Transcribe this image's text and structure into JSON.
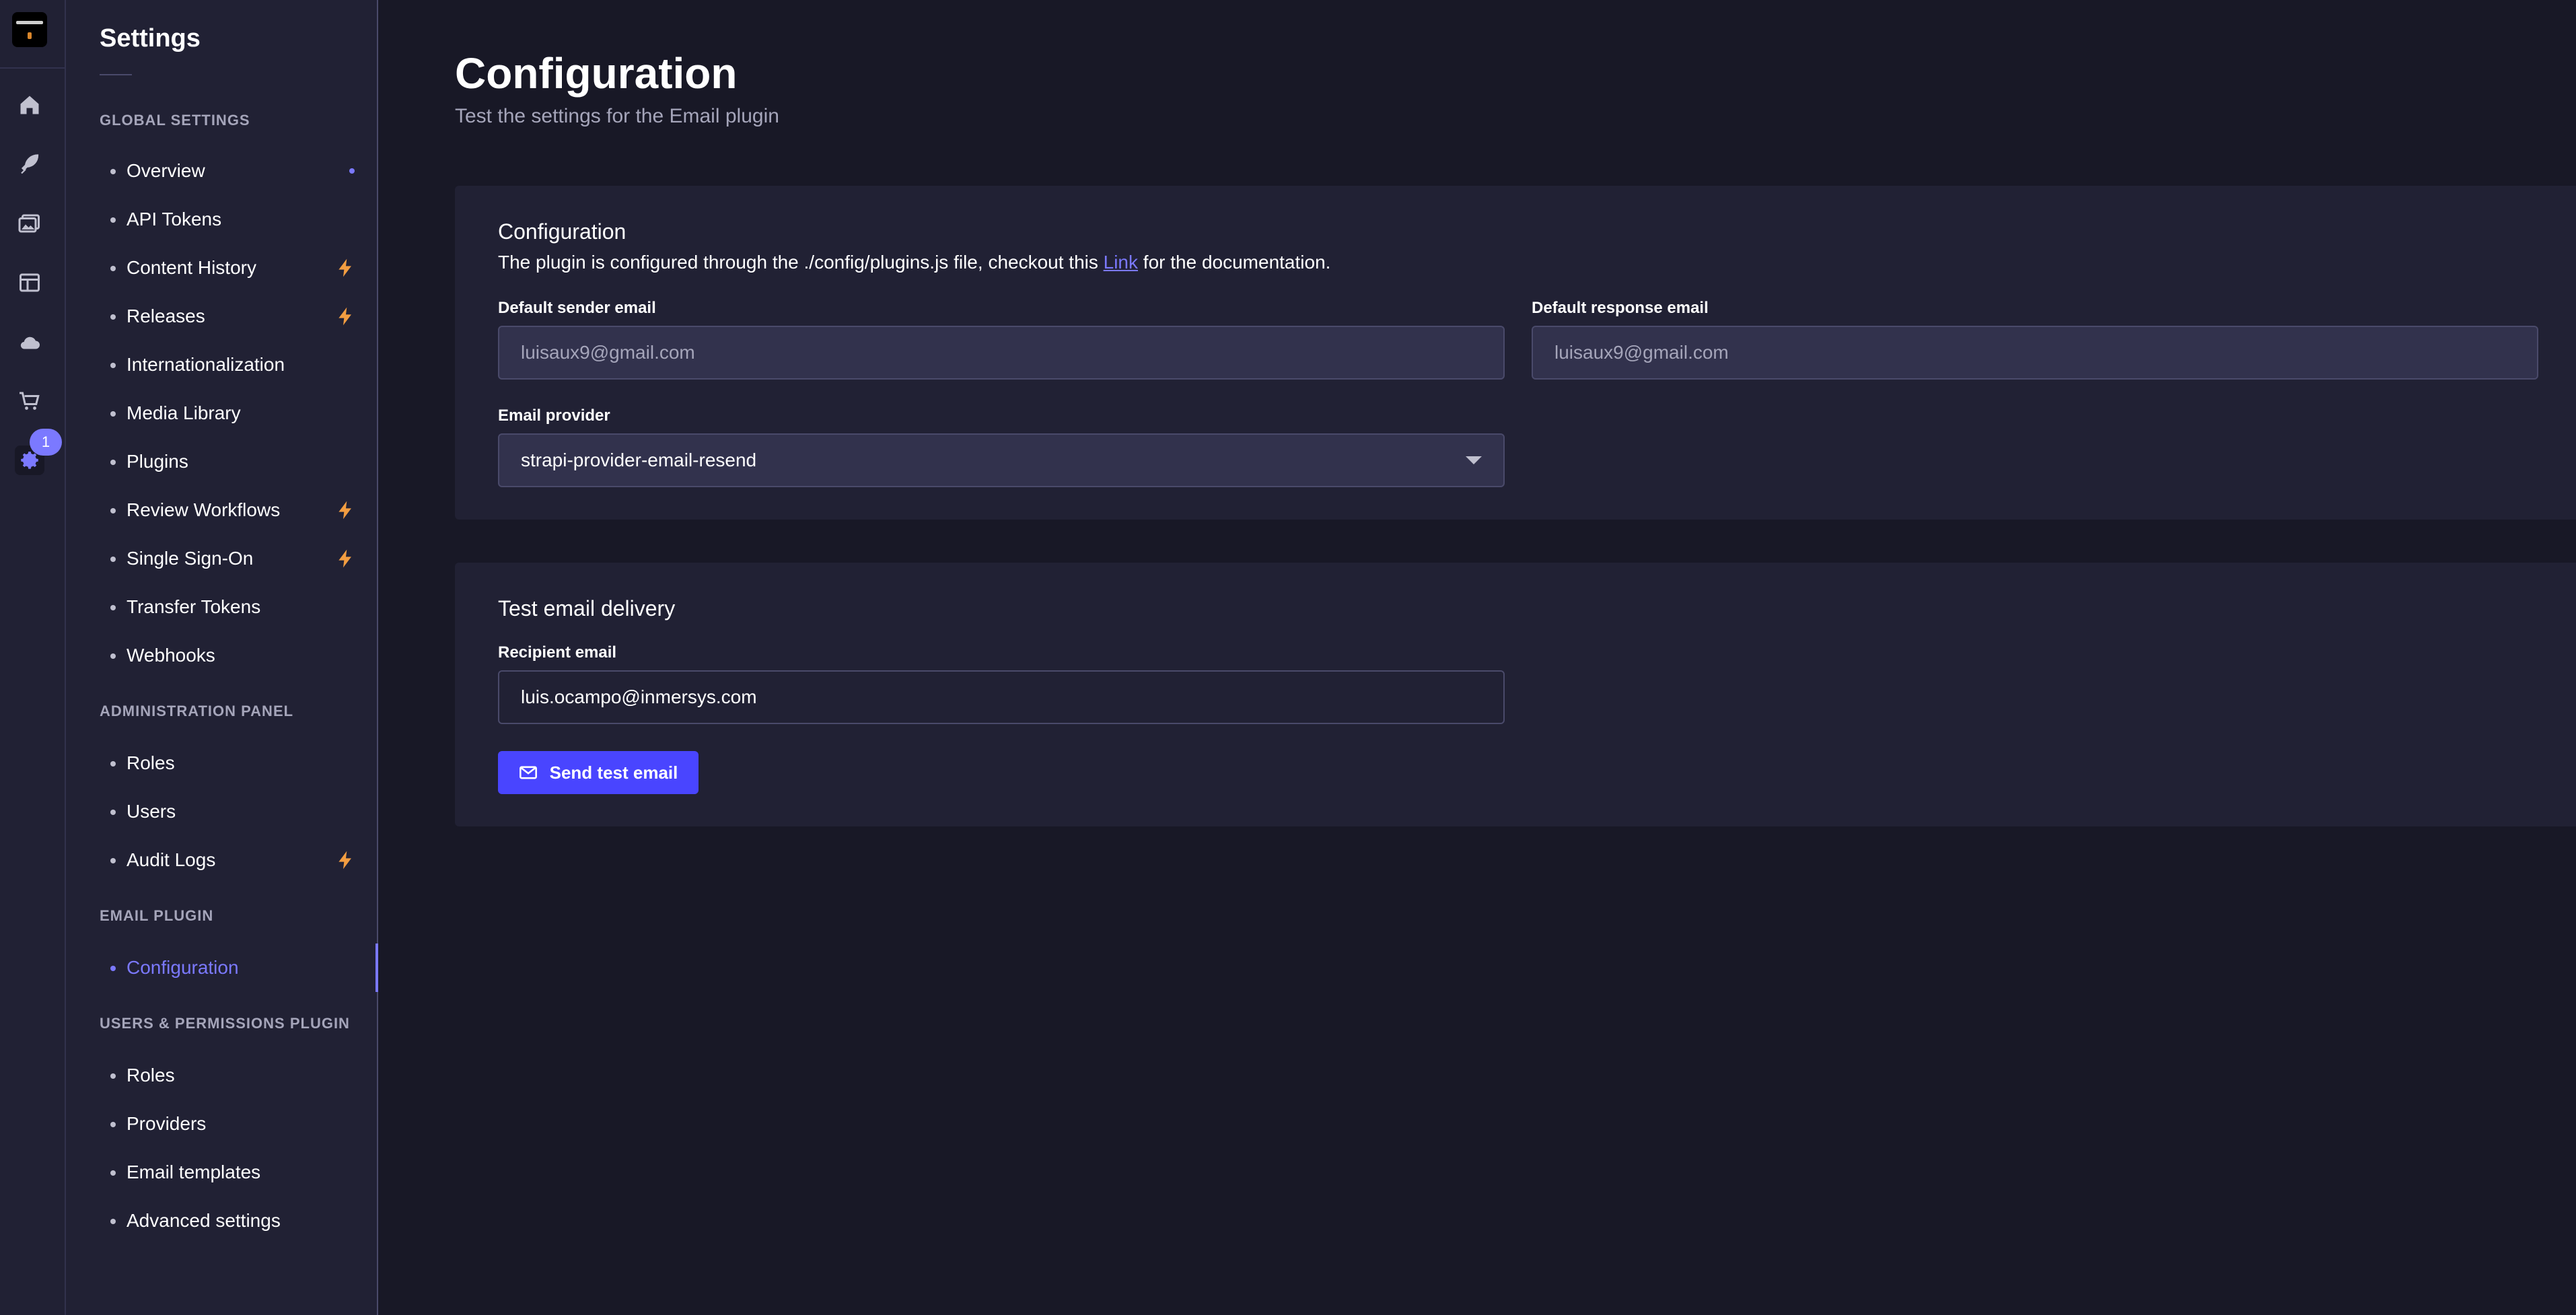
{
  "app": {
    "sidebar_title": "Settings",
    "notification_count": "1"
  },
  "rail": {
    "icons": [
      "logo",
      "home-icon",
      "feather-icon",
      "images-icon",
      "layout-icon",
      "cloud-icon",
      "cart-icon",
      "gear-icon"
    ]
  },
  "sidebar": {
    "sections": {
      "global": "Global Settings",
      "admin": "Administration Panel",
      "email": "Email Plugin",
      "users": "Users & Permissions Plugin"
    },
    "global_items": [
      {
        "label": "Overview",
        "badge": "dot"
      },
      {
        "label": "API Tokens",
        "badge": ""
      },
      {
        "label": "Content History",
        "badge": "bolt"
      },
      {
        "label": "Releases",
        "badge": "bolt"
      },
      {
        "label": "Internationalization",
        "badge": ""
      },
      {
        "label": "Media Library",
        "badge": ""
      },
      {
        "label": "Plugins",
        "badge": ""
      },
      {
        "label": "Review Workflows",
        "badge": "bolt"
      },
      {
        "label": "Single Sign-On",
        "badge": "bolt"
      },
      {
        "label": "Transfer Tokens",
        "badge": ""
      },
      {
        "label": "Webhooks",
        "badge": ""
      }
    ],
    "admin_items": [
      {
        "label": "Roles",
        "badge": ""
      },
      {
        "label": "Users",
        "badge": ""
      },
      {
        "label": "Audit Logs",
        "badge": "bolt"
      }
    ],
    "email_items": [
      {
        "label": "Configuration",
        "badge": "",
        "active": true
      }
    ],
    "users_items": [
      {
        "label": "Roles",
        "badge": ""
      },
      {
        "label": "Providers",
        "badge": ""
      },
      {
        "label": "Email templates",
        "badge": ""
      },
      {
        "label": "Advanced settings",
        "badge": ""
      }
    ]
  },
  "main": {
    "title": "Configuration",
    "subtitle": "Test the settings for the Email plugin",
    "config_card": {
      "heading": "Configuration",
      "desc_before": "The plugin is configured through the ./config/plugins.js file, checkout this ",
      "desc_link": "Link",
      "desc_after": " for the documentation.",
      "sender_label": "Default sender email",
      "sender_value": "luisaux9@gmail.com",
      "response_label": "Default response email",
      "response_value": "luisaux9@gmail.com",
      "provider_label": "Email provider",
      "provider_value": "strapi-provider-email-resend"
    },
    "test_card": {
      "heading": "Test email delivery",
      "recipient_label": "Recipient email",
      "recipient_value": "luis.ocampo@inmersys.com",
      "send_label": "Send test email"
    }
  },
  "colors": {
    "accent": "#7b79ff",
    "primary_button": "#4945ff",
    "bolt": "#f29d41",
    "background": "#181826",
    "surface": "#212134"
  }
}
